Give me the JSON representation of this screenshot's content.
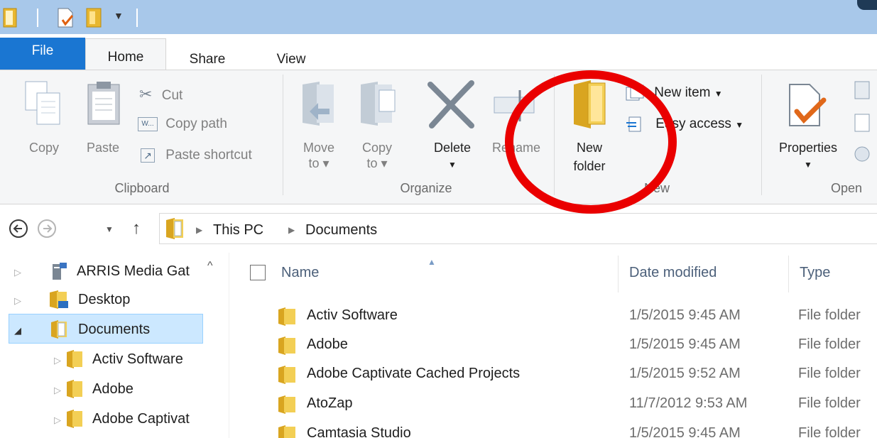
{
  "ribbon_tabs": {
    "file": "File",
    "home": "Home",
    "share": "Share",
    "view": "View"
  },
  "clipboard": {
    "copy": "Copy",
    "paste": "Paste",
    "cut": "Cut",
    "copy_path": "Copy path",
    "paste_shortcut": "Paste shortcut",
    "group": "Clipboard"
  },
  "organize": {
    "move_to_line1": "Move",
    "move_to_line2": "to",
    "copy_to_line1": "Copy",
    "copy_to_line2": "to",
    "delete": "Delete",
    "rename": "Rename",
    "group": "Organize"
  },
  "new_group": {
    "new_folder_line1": "New",
    "new_folder_line2": "folder",
    "new_item": "New item",
    "easy_access": "Easy access",
    "group": "New"
  },
  "open_group": {
    "properties": "Properties",
    "group": "Open"
  },
  "address": {
    "crumbs": [
      "This PC",
      "Documents"
    ]
  },
  "nav": {
    "items": [
      {
        "label": "ARRIS Media Gat",
        "icon": "media-server-icon"
      },
      {
        "label": "Desktop",
        "icon": "desktop-folder-icon"
      },
      {
        "label": "Documents",
        "icon": "documents-icon"
      },
      {
        "label": "Activ Software",
        "icon": "folder-icon"
      },
      {
        "label": "Adobe",
        "icon": "folder-icon"
      },
      {
        "label": "Adobe Captivat",
        "icon": "folder-icon"
      }
    ]
  },
  "files": {
    "columns": {
      "name": "Name",
      "date": "Date modified",
      "type": "Type"
    },
    "rows": [
      {
        "name": "Activ Software",
        "date": "1/5/2015 9:45 AM",
        "type": "File folder"
      },
      {
        "name": "Adobe",
        "date": "1/5/2015 9:45 AM",
        "type": "File folder"
      },
      {
        "name": "Adobe Captivate Cached Projects",
        "date": "1/5/2015 9:52 AM",
        "type": "File folder"
      },
      {
        "name": "AtoZap",
        "date": "11/7/2012 9:53 AM",
        "type": "File folder"
      },
      {
        "name": "Camtasia Studio",
        "date": "1/5/2015 9:45 AM",
        "type": "File folder"
      }
    ]
  },
  "colors": {
    "title_bar": "#a8c8ea",
    "file_tab": "#1a76d2",
    "selection": "#cce8ff",
    "highlight_ring": "#ea0000",
    "folder": "#e8b730"
  }
}
